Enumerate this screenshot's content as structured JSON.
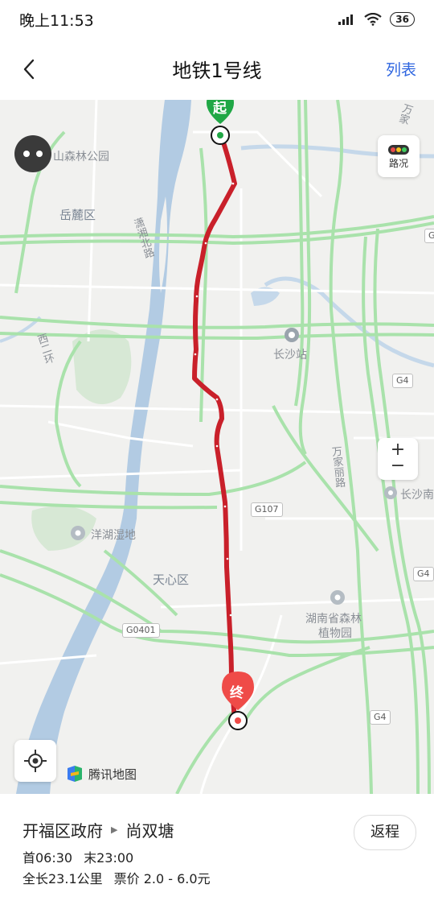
{
  "status_bar": {
    "time": "晚上11:53",
    "battery": "36",
    "icons": [
      "signal-icon",
      "wifi-icon",
      "battery-icon"
    ]
  },
  "nav": {
    "back_icon": "chevron-left-icon",
    "title": "地铁1号线",
    "action_label": "列表"
  },
  "map": {
    "labels": {
      "park_top": "山森林公园",
      "yuelu": "岳麓区",
      "xiaoxiang_road": "潇湘北路",
      "west_second_ring": "西二环",
      "changsha_station": "长沙站",
      "yanghu_wetland": "洋湖湿地",
      "tianxin": "天心区",
      "hunan_botanical_1": "湖南省森林",
      "hunan_botanical_2": "植物园",
      "wanjiali_road": "万家丽路",
      "wanjiali_top": "万家",
      "changsha_south": "长沙南"
    },
    "road_shields": {
      "g107": "G107",
      "g0401": "G0401",
      "g4_a": "G4",
      "g4_b": "G4",
      "g4_c": "G4",
      "g_top": "G"
    },
    "start_marker": "起",
    "end_marker": "终",
    "traffic_label": "路况",
    "zoom_in": "+",
    "zoom_out": "−",
    "brand": "腾讯地图",
    "line_color": "#c9202a",
    "road_color": "#a9e2ab"
  },
  "route": {
    "from": "开福区政府",
    "to": "尚双塘",
    "first_label": "首06:30",
    "last_label": "末23:00",
    "length": "全长23.1公里",
    "fare": "票价 2.0 - 6.0元",
    "return_label": "返程"
  }
}
